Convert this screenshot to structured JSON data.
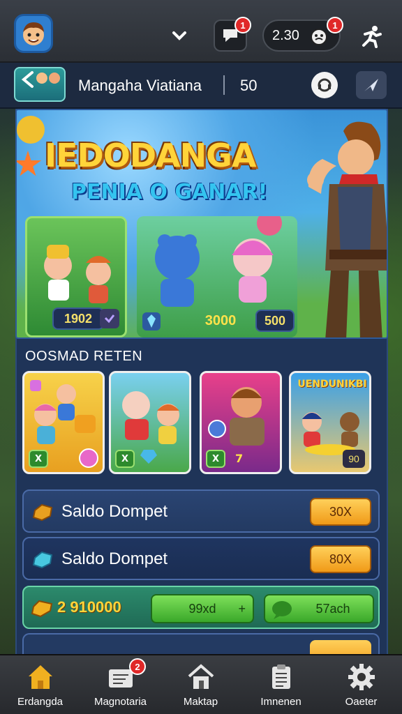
{
  "topbar": {
    "coin_value": "2.30",
    "notification_badge": "1",
    "coin_badge": "1"
  },
  "header": {
    "title": "Mangaha Viatiana",
    "count": "50"
  },
  "banner": {
    "headline": "IEDODANGA",
    "subline": "PENIA O GANAR!",
    "card_a_value": "1902",
    "card_b_value_1": "3000",
    "card_b_value_2": "500"
  },
  "section": {
    "label": "OOSMAD RETEN"
  },
  "games": [
    {
      "chip": "X",
      "badge": ""
    },
    {
      "chip": "X",
      "badge": ""
    },
    {
      "chip": "X",
      "badge": "7"
    },
    {
      "title": "UENDUNIKBI",
      "badge": "90"
    }
  ],
  "rows": [
    {
      "label": "Saldo Dompet",
      "pill": "30X",
      "gem_color": "#e8a020"
    },
    {
      "label": "Saldo Dompet",
      "pill": "80X",
      "gem_color": "#48c8e0"
    }
  ],
  "green_row": {
    "value": "2 910000",
    "button_1": "99xd",
    "button_2": "57ach"
  },
  "nav": [
    {
      "label": "Erdangda",
      "icon": "home-icon"
    },
    {
      "label": "Magnotaria",
      "icon": "message-icon",
      "badge": "2"
    },
    {
      "label": "Maktap",
      "icon": "house-icon"
    },
    {
      "label": "Imnenen",
      "icon": "clipboard-icon"
    },
    {
      "label": "Oaeter",
      "icon": "gear-icon"
    }
  ],
  "colors": {
    "accent_gold": "#ffd43a",
    "badge_red": "#e02828",
    "panel_blue": "#1f3458",
    "nav_active": "#f0b020"
  }
}
